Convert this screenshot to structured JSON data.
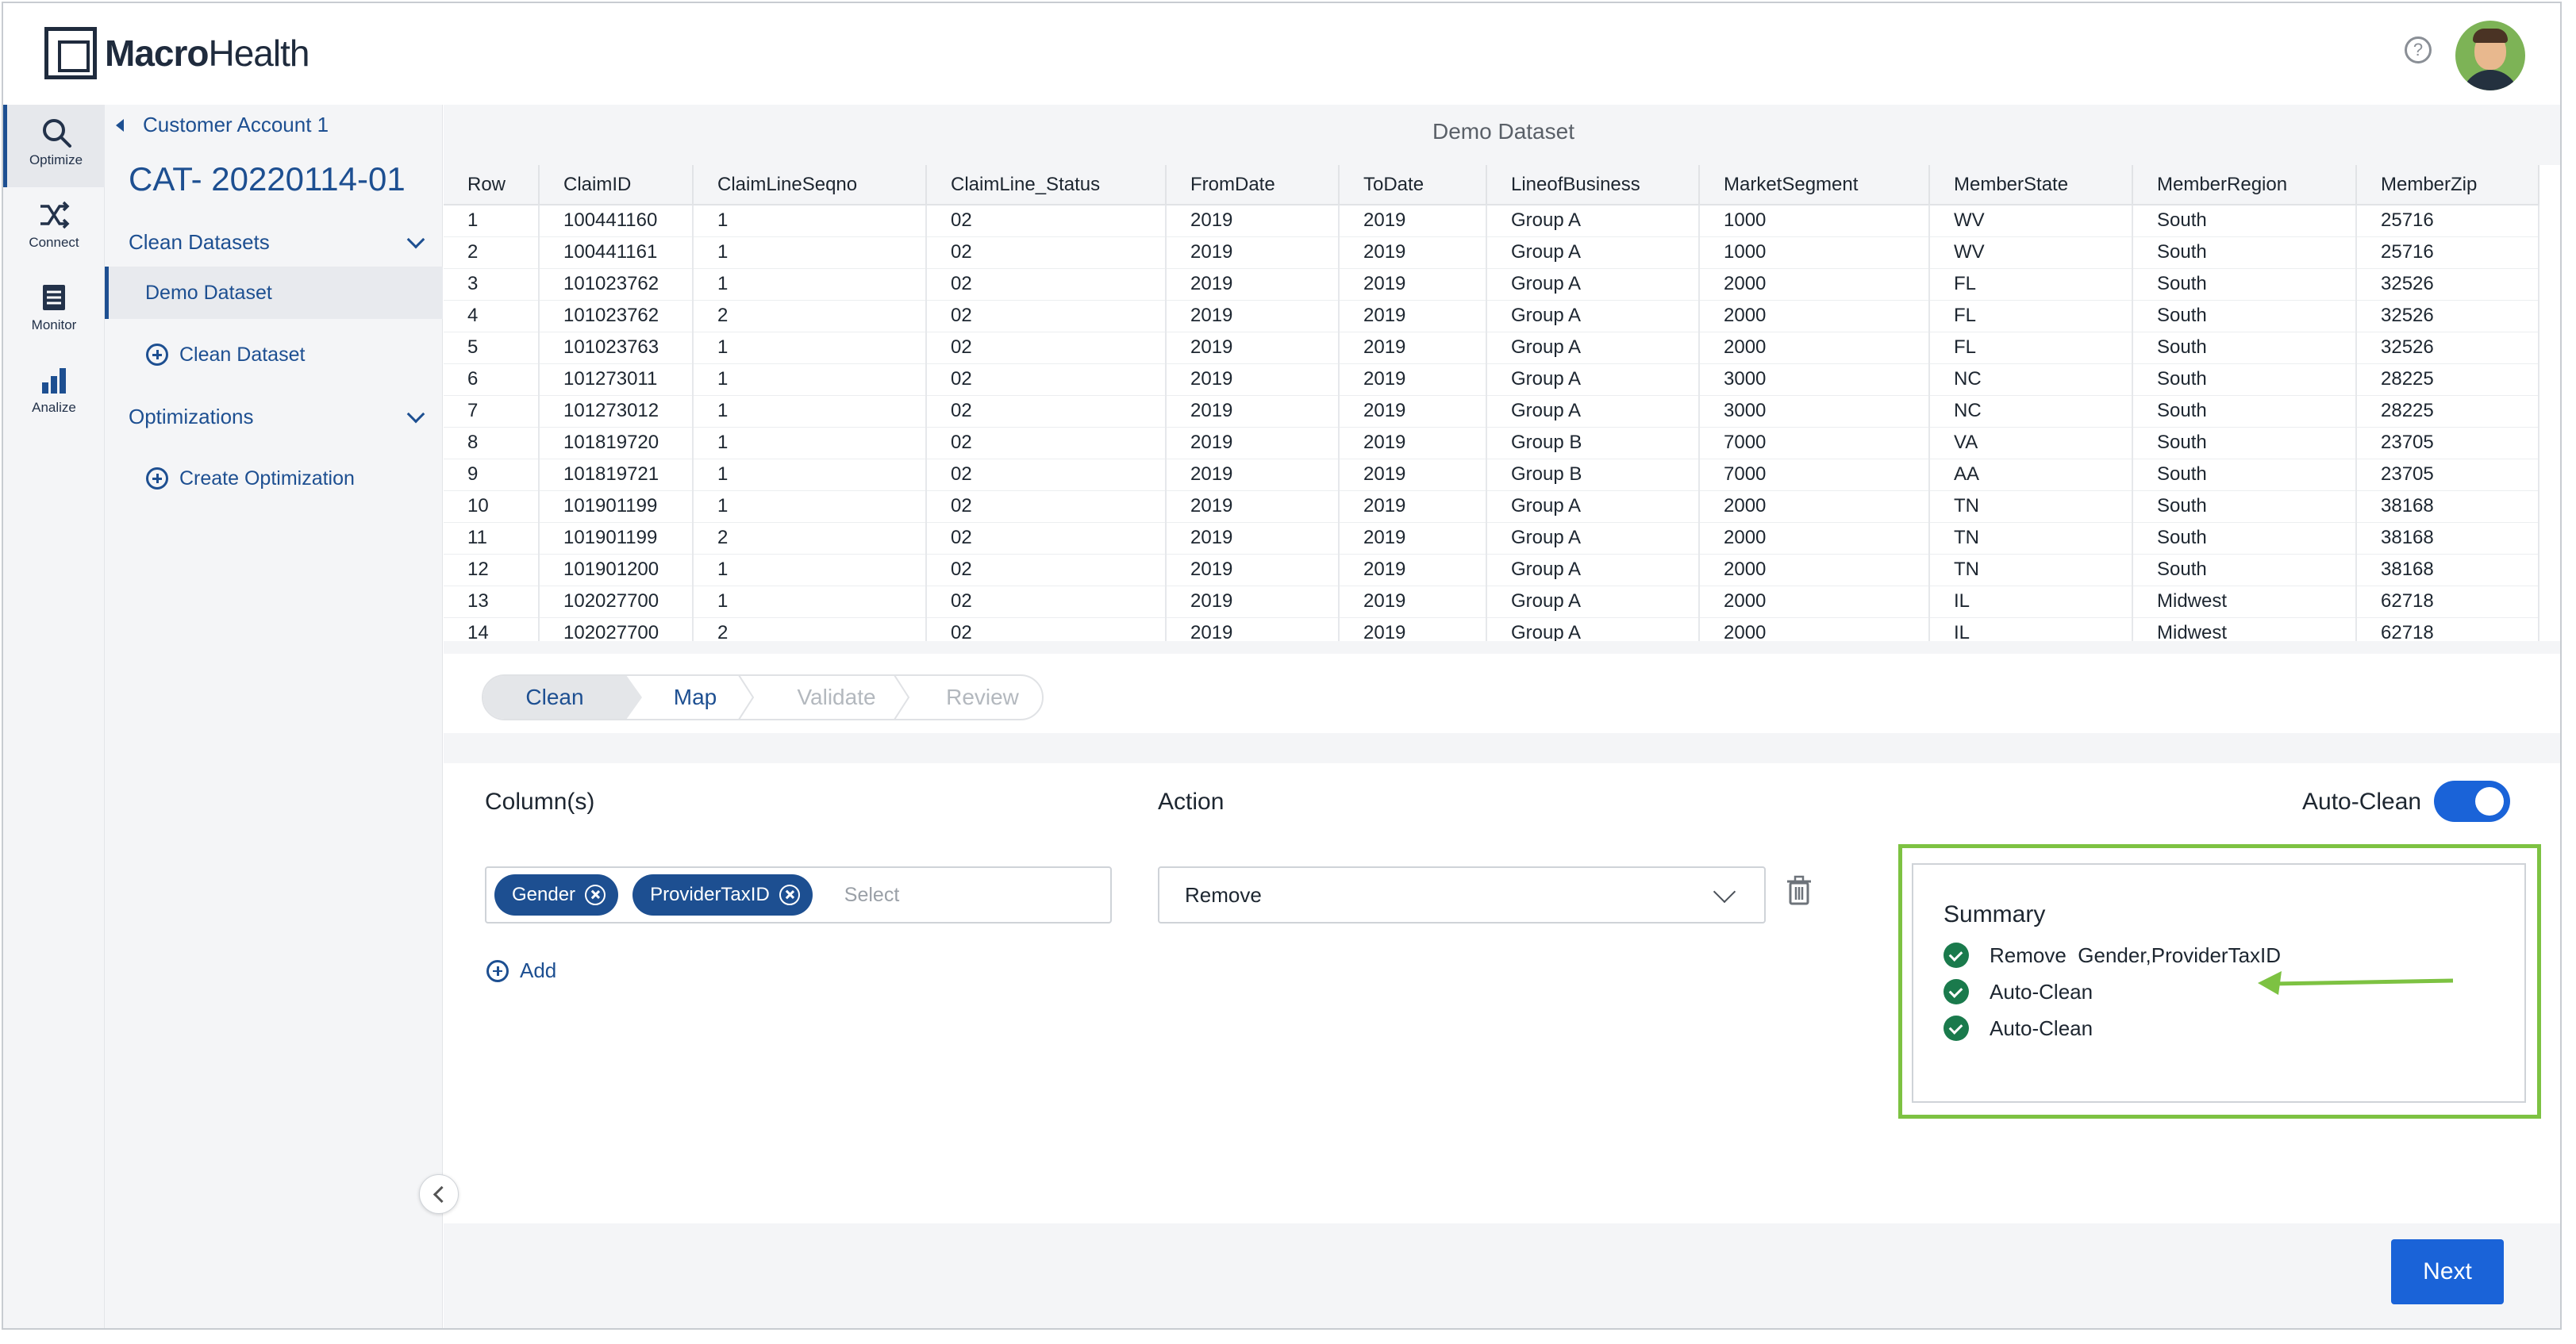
{
  "header": {
    "logo_text_bold": "Macro",
    "logo_text_rest": "Health",
    "help_label": "?"
  },
  "rail": {
    "items": [
      {
        "label": "Optimize",
        "icon": "search-icon"
      },
      {
        "label": "Connect",
        "icon": "shuffle-icon"
      },
      {
        "label": "Monitor",
        "icon": "monitor-icon"
      },
      {
        "label": "Analize",
        "icon": "bar-chart-icon"
      }
    ]
  },
  "side": {
    "breadcrumb": "Customer Account 1",
    "title": "CAT- 20220114-01",
    "section_datasets": "Clean Datasets",
    "dataset_item": "Demo Dataset",
    "add_dataset": "Clean Dataset",
    "section_optimizations": "Optimizations",
    "add_optimization": "Create Optimization"
  },
  "table": {
    "title": "Demo Dataset",
    "columns": [
      "Row",
      "ClaimID",
      "ClaimLineSeqno",
      "ClaimLine_Status",
      "FromDate",
      "ToDate",
      "LineofBusiness",
      "MarketSegment",
      "MemberState",
      "MemberRegion",
      "MemberZip"
    ],
    "rows": [
      [
        "1",
        "100441160",
        "1",
        "02",
        "2019",
        "2019",
        "Group A",
        "1000",
        "WV",
        "South",
        "25716"
      ],
      [
        "2",
        "100441161",
        "1",
        "02",
        "2019",
        "2019",
        "Group A",
        "1000",
        "WV",
        "South",
        "25716"
      ],
      [
        "3",
        "101023762",
        "1",
        "02",
        "2019",
        "2019",
        "Group A",
        "2000",
        "FL",
        "South",
        "32526"
      ],
      [
        "4",
        "101023762",
        "2",
        "02",
        "2019",
        "2019",
        "Group A",
        "2000",
        "FL",
        "South",
        "32526"
      ],
      [
        "5",
        "101023763",
        "1",
        "02",
        "2019",
        "2019",
        "Group A",
        "2000",
        "FL",
        "South",
        "32526"
      ],
      [
        "6",
        "101273011",
        "1",
        "02",
        "2019",
        "2019",
        "Group A",
        "3000",
        "NC",
        "South",
        "28225"
      ],
      [
        "7",
        "101273012",
        "1",
        "02",
        "2019",
        "2019",
        "Group A",
        "3000",
        "NC",
        "South",
        "28225"
      ],
      [
        "8",
        "101819720",
        "1",
        "02",
        "2019",
        "2019",
        "Group B",
        "7000",
        "VA",
        "South",
        "23705"
      ],
      [
        "9",
        "101819721",
        "1",
        "02",
        "2019",
        "2019",
        "Group B",
        "7000",
        "AA",
        "South",
        "23705"
      ],
      [
        "10",
        "101901199",
        "1",
        "02",
        "2019",
        "2019",
        "Group A",
        "2000",
        "TN",
        "South",
        "38168"
      ],
      [
        "11",
        "101901199",
        "2",
        "02",
        "2019",
        "2019",
        "Group A",
        "2000",
        "TN",
        "South",
        "38168"
      ],
      [
        "12",
        "101901200",
        "1",
        "02",
        "2019",
        "2019",
        "Group A",
        "2000",
        "TN",
        "South",
        "38168"
      ],
      [
        "13",
        "102027700",
        "1",
        "02",
        "2019",
        "2019",
        "Group A",
        "2000",
        "IL",
        "Midwest",
        "62718"
      ],
      [
        "14",
        "102027700",
        "2",
        "02",
        "2019",
        "2019",
        "Group A",
        "2000",
        "IL",
        "Midwest",
        "62718"
      ]
    ]
  },
  "steps": [
    {
      "label": "Clean",
      "state": "done"
    },
    {
      "label": "Map",
      "state": "current"
    },
    {
      "label": "Validate",
      "state": "pending"
    },
    {
      "label": "Review",
      "state": "pending"
    }
  ],
  "form": {
    "columns_label": "Column(s)",
    "action_label": "Action",
    "chips": [
      "Gender",
      "ProviderTaxID"
    ],
    "select_placeholder": "Select",
    "action_value": "Remove",
    "add_label": "Add",
    "auto_clean_label": "Auto-Clean",
    "auto_clean_on": true
  },
  "summary": {
    "title": "Summary",
    "items": [
      "Remove  Gender,ProviderTaxID",
      "Auto-Clean",
      "Auto-Clean"
    ]
  },
  "footer": {
    "next_label": "Next"
  },
  "colors": {
    "primary": "#1d4f91",
    "accent_blue": "#1a63d8",
    "highlight_green": "#7dc242",
    "check_green": "#1a7a4c"
  }
}
